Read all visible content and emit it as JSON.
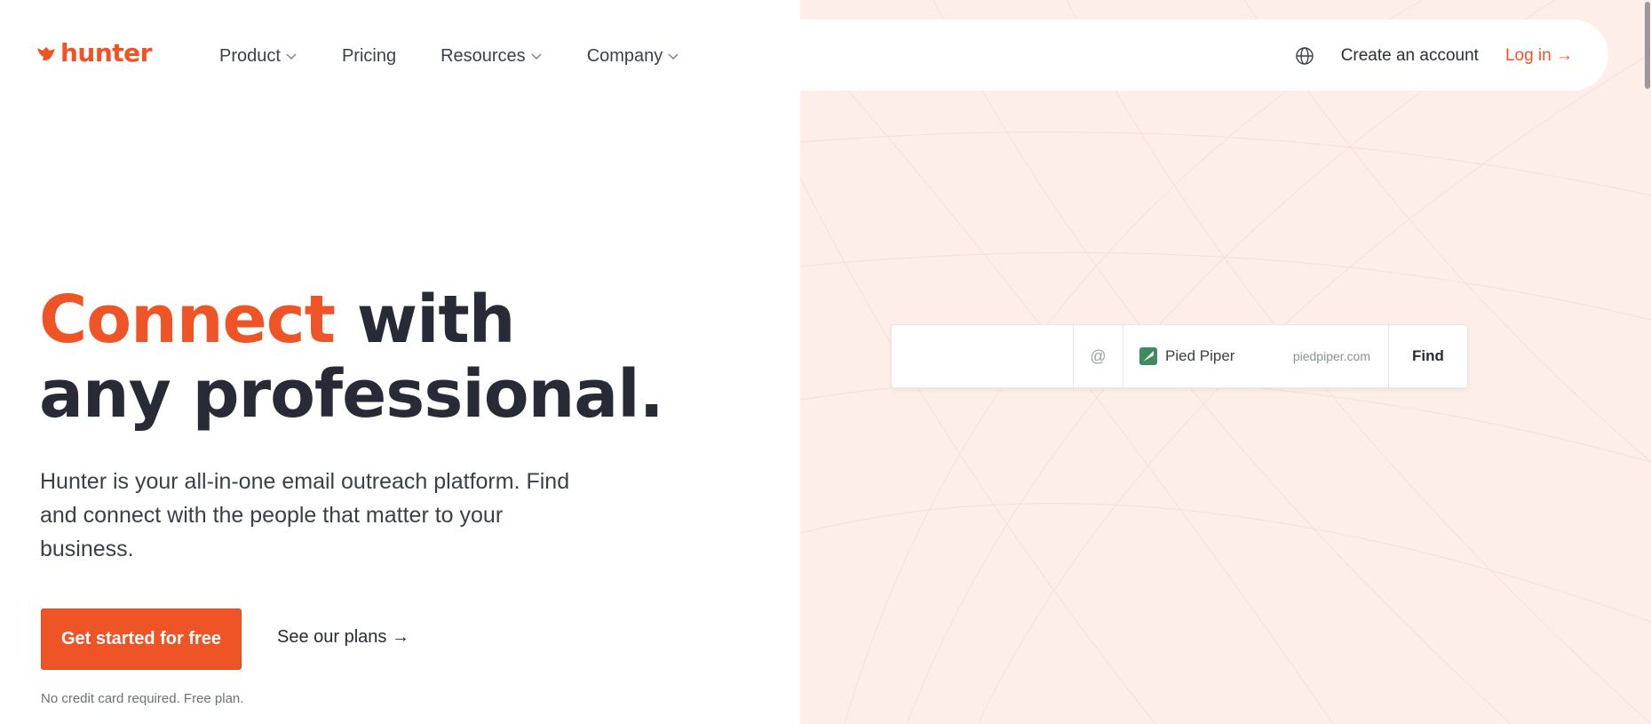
{
  "brand": {
    "name": "hunter",
    "color": "#ef5426"
  },
  "nav": {
    "items": [
      {
        "label": "Product",
        "dropdown": true
      },
      {
        "label": "Pricing",
        "dropdown": false
      },
      {
        "label": "Resources",
        "dropdown": true
      },
      {
        "label": "Company",
        "dropdown": true
      }
    ],
    "language_icon": "globe-icon",
    "create_account": "Create an account",
    "login": "Log in →"
  },
  "hero": {
    "title_accent": "Connect",
    "title_rest_line1": " with",
    "title_line2": "any professional.",
    "description": "Hunter is your all-in-one email outreach platform. Find and connect with the people that matter to your business.",
    "cta_primary": "Get started for free",
    "cta_secondary": "See our plans →",
    "note": "No credit card required. Free plan."
  },
  "finder": {
    "input_value": "",
    "at_symbol": "@",
    "company_name": "Pied Piper",
    "company_domain": "piedpiper.com",
    "button_label": "Find",
    "company_icon": "pied-piper-logo-icon",
    "company_icon_color": "#3d8b5e"
  },
  "colors": {
    "accent": "#ef5426",
    "panel_background": "#fdeee9",
    "heading": "#262b35"
  }
}
